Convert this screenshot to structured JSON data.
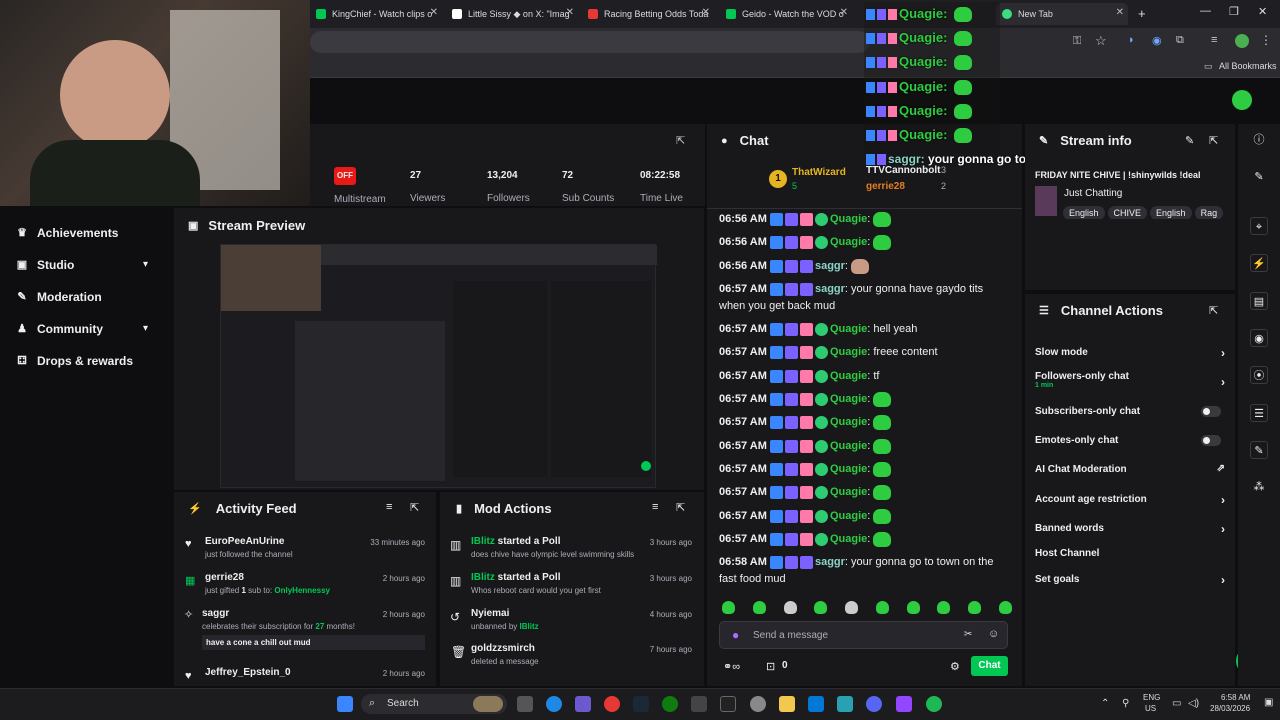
{
  "browser": {
    "tabs": [
      {
        "title": "KingChief - Watch clips o",
        "color": "#00c853"
      },
      {
        "title": "Little Sissy ◆ on X: \"Imag",
        "color": "#ffffff"
      },
      {
        "title": "Racing Betting Odds Toda",
        "color": "#e53935"
      },
      {
        "title": "Geido - Watch the VOD o",
        "color": "#00c853"
      },
      {
        "title": "New Tab",
        "color": "#3ddc84"
      }
    ],
    "bookmarks_label": "All Bookmarks",
    "new_tab_symbol": "+"
  },
  "stats": [
    {
      "value": "OFF",
      "label": "Multistream"
    },
    {
      "value": "27",
      "label": "Viewers"
    },
    {
      "value": "13,204",
      "label": "Followers"
    },
    {
      "value": "72",
      "label": "Sub Counts"
    },
    {
      "value": "08:22:58",
      "label": "Time Live"
    }
  ],
  "nav": {
    "items": [
      {
        "label": "Achievements",
        "icon": "trophy-icon"
      },
      {
        "label": "Studio",
        "icon": "studio-icon"
      },
      {
        "label": "Moderation",
        "icon": "wrench-icon"
      },
      {
        "label": "Community",
        "icon": "community-icon"
      },
      {
        "label": "Drops & rewards",
        "icon": "gift-icon"
      }
    ]
  },
  "stream_preview": {
    "title": "Stream Preview"
  },
  "activity_feed": {
    "title": "Activity Feed",
    "items": [
      {
        "name": "EuroPeeAnUrine",
        "detail": "just followed the channel",
        "time": "33 minutes ago",
        "icon": "heart-icon"
      },
      {
        "name": "gerrie28",
        "detail_prefix": "just gifted ",
        "detail_count": "1",
        "detail_mid": " sub to: ",
        "detail_target": "OnlyHennessy",
        "time": "2 hours ago",
        "icon": "gift-icon"
      },
      {
        "name": "saggr",
        "detail_prefix": "celebrates their subscription for ",
        "detail_count": "27",
        "detail_suffix": " months!",
        "message": "have a cone a chill out mud",
        "time": "2 hours ago",
        "icon": "star-icon"
      },
      {
        "name": "Jeffrey_Epstein_0",
        "time": "2 hours ago",
        "icon": "heart-icon"
      }
    ]
  },
  "mod_actions": {
    "title": "Mod Actions",
    "items": [
      {
        "actor": "IBlitz",
        "action": " started a Poll",
        "detail": "does chive have olympic level swimming skills",
        "time": "3 hours ago"
      },
      {
        "actor": "IBlitz",
        "action": " started a Poll",
        "detail": "Whos reboot card would you get first",
        "time": "3 hours ago"
      },
      {
        "actor": "Nyiemai",
        "action": "",
        "detail_prefix": "unbanned by ",
        "detail_actor": "IBlitz",
        "time": "4 hours ago"
      },
      {
        "actor": "goldzzsmirch",
        "action": "",
        "detail": "deleted a message",
        "time": "7 hours ago"
      }
    ]
  },
  "chat": {
    "title": "Chat",
    "leaderboard": [
      {
        "rank": "1",
        "name": "ThatWizard",
        "count": "5"
      },
      {
        "name": "TTVCannonbolt",
        "count": "3"
      },
      {
        "name": "gerrie28",
        "count": "2"
      }
    ],
    "messages": [
      {
        "time": "06:56 AM",
        "user": "Quagie",
        "text": "",
        "emote": true
      },
      {
        "time": "06:56 AM",
        "user": "Quagie",
        "text": "",
        "emote": true
      },
      {
        "time": "06:56 AM",
        "user": "saggr",
        "text": "",
        "emote": false
      },
      {
        "time": "06:57 AM",
        "user": "saggr",
        "text": "your gonna have gaydo tits when you get back mud"
      },
      {
        "time": "06:57 AM",
        "user": "Quagie",
        "text": "hell yeah"
      },
      {
        "time": "06:57 AM",
        "user": "Quagie",
        "text": "freee content"
      },
      {
        "time": "06:57 AM",
        "user": "Quagie",
        "text": "tf"
      },
      {
        "time": "06:57 AM",
        "user": "Quagie",
        "text": "",
        "emote": true
      },
      {
        "time": "06:57 AM",
        "user": "Quagie",
        "text": "",
        "emote": true
      },
      {
        "time": "06:57 AM",
        "user": "Quagie",
        "text": "",
        "emote": true
      },
      {
        "time": "06:57 AM",
        "user": "Quagie",
        "text": "",
        "emote": true
      },
      {
        "time": "06:57 AM",
        "user": "Quagie",
        "text": "",
        "emote": true
      },
      {
        "time": "06:57 AM",
        "user": "Quagie",
        "text": "",
        "emote": true
      },
      {
        "time": "06:57 AM",
        "user": "Quagie",
        "text": "",
        "emote": true
      },
      {
        "time": "06:58 AM",
        "user": "saggr",
        "text": "your gonna go to town on the fast food mud"
      }
    ],
    "input_placeholder": "Send a message",
    "send_label": "Chat",
    "points": "0"
  },
  "overlay": {
    "lines": [
      "Quagie:",
      "Quagie:",
      "Quagie:",
      "Quagie:",
      "Quagie:",
      "Quagie:"
    ],
    "last_user": "saggr:",
    "last_text": "your gonna go to town on the fast food mud"
  },
  "stream_info": {
    "title": "Stream info",
    "stream_title": "FRIDAY NITE CHIVE | !shinywilds !deal",
    "category": "Just Chatting",
    "tags": [
      "English",
      "CHIVE",
      "English",
      "Rag"
    ]
  },
  "channel_actions": {
    "title": "Channel Actions",
    "items": [
      {
        "label": "Slow mode",
        "type": "arrow"
      },
      {
        "label": "Followers-only chat",
        "sub": "1 min",
        "type": "arrow"
      },
      {
        "label": "Subscribers-only chat",
        "type": "toggle"
      },
      {
        "label": "Emotes-only chat",
        "type": "toggle"
      },
      {
        "label": "AI Chat Moderation",
        "type": "external"
      },
      {
        "label": "Account age restriction",
        "type": "arrow"
      },
      {
        "label": "Banned words",
        "type": "arrow"
      },
      {
        "label": "Host Channel",
        "type": "none"
      },
      {
        "label": "Set goals",
        "type": "arrow"
      }
    ]
  },
  "taskbar": {
    "search_label": "Search",
    "lang": "ENG",
    "region": "US",
    "time": "6:58 AM",
    "date": "28/03/2026"
  },
  "colors": {
    "accent": "#00c853",
    "twitch_bg": "#0e0e10",
    "panel": "#18181b",
    "off_badge": "#e91916",
    "quagie": "#2ecc40"
  }
}
